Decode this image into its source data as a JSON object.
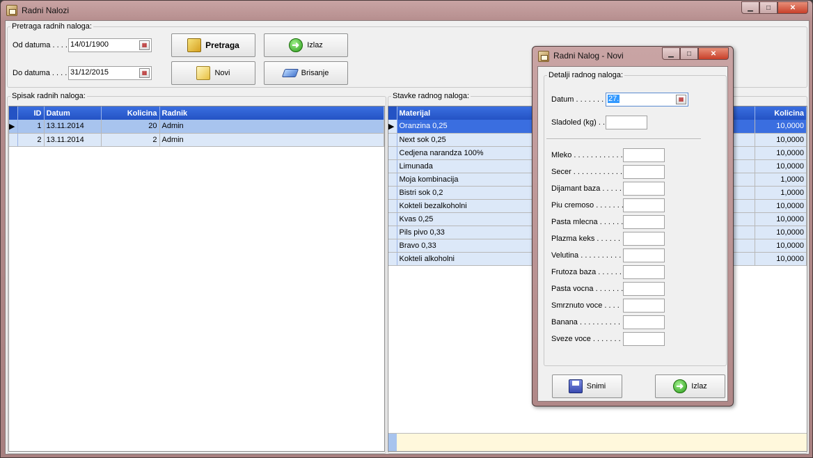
{
  "window": {
    "title": "Radni Nalozi"
  },
  "search": {
    "legend": "Pretraga radnih naloga:",
    "od_label": "Od datuma . . . . .",
    "od_value": "14/01/1900",
    "do_label": "Do datuma . . . . .",
    "do_value": "31/12/2015",
    "pretraga_label": "Pretraga",
    "izlaz_label": "Izlaz",
    "novi_label": "Novi",
    "brisanje_label": "Brisanje"
  },
  "orders": {
    "legend": "Spisak radnih naloga:",
    "columns": [
      "ID",
      "Datum",
      "Kolicina",
      "Radnik"
    ],
    "rows": [
      {
        "id": "1",
        "datum": "13.11.2014",
        "kolicina": "20",
        "radnik": "Admin"
      },
      {
        "id": "2",
        "datum": "13.11.2014",
        "kolicina": "2",
        "radnik": "Admin"
      }
    ]
  },
  "items": {
    "legend": "Stavke radnog naloga:",
    "columns": [
      "Materijal",
      "Kolicina"
    ],
    "rows": [
      {
        "materijal": "Oranzina 0,25",
        "kolicina": "10,0000"
      },
      {
        "materijal": "Next sok 0,25",
        "kolicina": "10,0000"
      },
      {
        "materijal": "Cedjena narandza 100%",
        "kolicina": "10,0000"
      },
      {
        "materijal": "Limunada",
        "kolicina": "10,0000"
      },
      {
        "materijal": "Moja kombinacija",
        "kolicina": "1,0000"
      },
      {
        "materijal": "Bistri sok 0,2",
        "kolicina": "1,0000"
      },
      {
        "materijal": "Kokteli bezalkoholni",
        "kolicina": "10,0000"
      },
      {
        "materijal": "Kvas 0,25",
        "kolicina": "10,0000"
      },
      {
        "materijal": "Pils pivo 0,33",
        "kolicina": "10,0000"
      },
      {
        "materijal": "Bravo 0,33",
        "kolicina": "10,0000"
      },
      {
        "materijal": "Kokteli alkoholni",
        "kolicina": "10,0000"
      }
    ]
  },
  "dialog": {
    "title": "Radni Nalog - Novi",
    "legend": "Detalji radnog naloga:",
    "datum_label": "Datum . . . . . . . .",
    "datum_value": "27.",
    "sladoled_label": "Sladoled (kg) . .",
    "fields": [
      "Mleko . . . . . . . . . . . .",
      "Secer . . . . . . . . . . . .",
      "Dijamant baza . . . . .",
      "Piu cremoso . . . . . . .",
      "Pasta mlecna . . . . . .",
      "Plazma keks . . . . . . .",
      "Velutina . . . . . . . . . .",
      "Frutoza baza . . . . . .",
      "Pasta vocna . . . . . . .",
      "Smrznuto voce . . . .",
      "Banana . . . . . . . . . .",
      "Sveze voce . . . . . . ."
    ],
    "snimi_label": "Snimi",
    "izlaz_label": "Izlaz"
  }
}
